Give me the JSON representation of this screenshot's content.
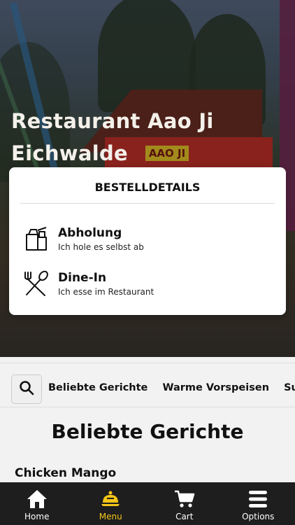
{
  "hero": {
    "title": "Restaurant Aao Ji Eichwalde",
    "sign_text": "AAO JI"
  },
  "order_card": {
    "title": "BESTELLDETAILS",
    "options": [
      {
        "icon": "takeaway-bag-icon",
        "title": "Abholung",
        "subtitle": "Ich hole es selbst ab"
      },
      {
        "icon": "fork-spoon-icon",
        "title": "Dine-In",
        "subtitle": "Ich esse im Restaurant"
      }
    ]
  },
  "categories": {
    "search_icon": "search-icon",
    "items": [
      "Beliebte Gerichte",
      "Warme Vorspeisen",
      "Su"
    ]
  },
  "section": {
    "title": "Beliebte Gerichte",
    "first_item": "Chicken Mango"
  },
  "tabbar": {
    "active_color": "#f5c518",
    "tabs": [
      {
        "label": "Home",
        "icon": "home-icon"
      },
      {
        "label": "Menu",
        "icon": "menu-cloche-icon",
        "active": true
      },
      {
        "label": "Cart",
        "icon": "cart-icon"
      },
      {
        "label": "Options",
        "icon": "hamburger-icon"
      }
    ]
  }
}
